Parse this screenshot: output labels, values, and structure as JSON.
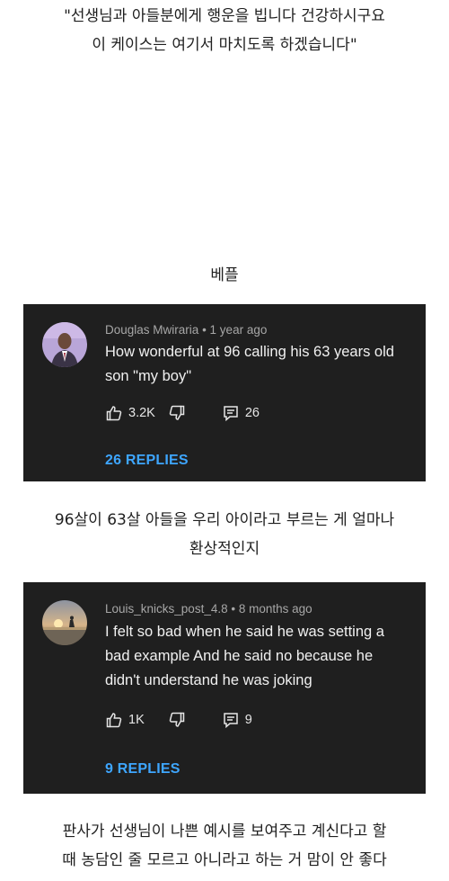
{
  "post": {
    "quote_lines": [
      "\"선생님과 아들분에게 행운을 빕니다 건강하시구요",
      "이 케이스는 여기서 마치도록 하겠습니다\""
    ],
    "best_reply_label": "베플",
    "translation_1_lines": [
      "96살이 63살 아들을 우리 아이라고 부르는 게 얼마나",
      "환상적인지"
    ],
    "translation_2_lines": [
      "판사가 선생님이 나쁜 예시를 보여주고 계신다고 할",
      "때 농담인 줄 모르고 아니라고 하는 거 맘이 안 좋다"
    ]
  },
  "comments": [
    {
      "author": "Douglas Mwiraria",
      "time": "1 year ago",
      "text_lines": [
        "How wonderful at 96 calling his 63 years old",
        "son \"my boy\""
      ],
      "likes": "3.2K",
      "reply_count": "26",
      "replies_label": "26 REPLIES",
      "avatar_icon": "person-photo-avatar"
    },
    {
      "author": "Louis_knicks_post_4.8",
      "time": "8 months ago",
      "text_lines": [
        "I felt so bad when he said he was setting a",
        "bad example And he said no because he",
        "didn't understand he was joking"
      ],
      "likes": "1K",
      "reply_count": "9",
      "replies_label": "9 REPLIES",
      "avatar_icon": "sunset-photo-avatar"
    }
  ],
  "colors": {
    "card_background": "#1f1f1f",
    "replies_link": "#3ea6ff",
    "meta_text": "#a7a7a7",
    "page_background": "#ffffff"
  }
}
